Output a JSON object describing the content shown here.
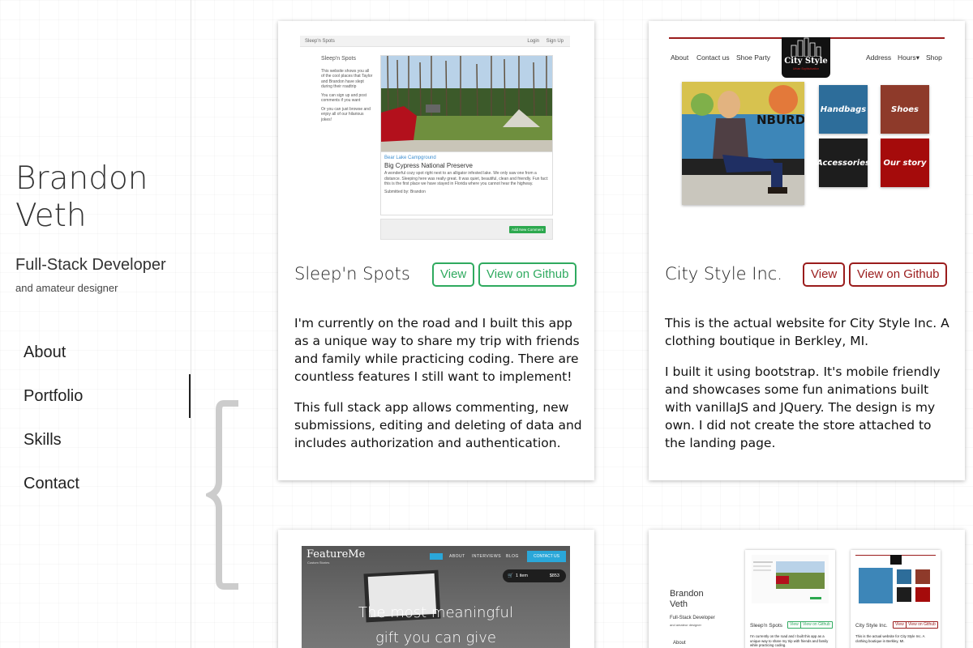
{
  "sidebar": {
    "name": "Brandon\nVeth",
    "role": "Full-Stack Developer",
    "subtitle": "and amateur designer",
    "nav": [
      {
        "label": "About"
      },
      {
        "label": "Portfolio",
        "active": true
      },
      {
        "label": "Skills"
      },
      {
        "label": "Contact"
      }
    ]
  },
  "projects": [
    {
      "title": "Sleep'n Spots",
      "view_label": "View",
      "github_label": "View on Github",
      "accent": "#2faa5f",
      "paragraphs": [
        "I'm currently on the road and I built this app as a unique way to share my trip with friends and family while practicing coding. There are countless features I still want to implement!",
        "This full stack app allows commenting, new submissions, editing and deleting of data and includes authorization and authentication."
      ],
      "preview": {
        "brand": "Sleep'n Spots",
        "login": "Login",
        "signup": "Sign Up",
        "side_heading": "Sleep'n Spots",
        "side_p1": "This website shows you all of the cool places that Taylor and Brandon have slept during their roadtrip",
        "side_p2": "You can sign up and post comments if you want",
        "side_p3": "Or you can just browse and enjoy all of our hilarious jokes!",
        "location": "Bear Lake Campground",
        "post_title": "Big Cypress National Preserve",
        "post_text": "A wonderful cozy spot right next to an alligator infested lake. We only saw one from a distance. Sleeping here was really great. It was quiet, beautiful, clean and friendly. Fun fact: this is the first place we have stayed in Florida where you cannot hear the highway.",
        "submitted": "Submitted by: Brandon",
        "add_comment": "Add New Comment"
      }
    },
    {
      "title": "City Style Inc.",
      "view_label": "View",
      "github_label": "View on Github",
      "accent": "#9a1c1c",
      "paragraphs": [
        "This is the actual website for City Style Inc. A clothing boutique in Berkley, MI.",
        "I built it using bootstrap. It's mobile friendly and showcases some fun animations built with vanillaJS and JQuery. The design is my own. I did not create the store attached to the landing page."
      ],
      "preview": {
        "nav_about": "About",
        "nav_contact": "Contact us",
        "nav_shoe": "Shoe Party",
        "logo": "City Style",
        "logo_sub": "Urban Sophistication",
        "nav_address": "Address",
        "nav_hours": "Hours",
        "nav_shop": "Shop",
        "tile_handbags": "Handbags",
        "tile_shoes": "Shoes",
        "tile_accessories": "Accessories",
        "tile_story": "Our story"
      }
    },
    {
      "preview": {
        "logo": "FeatureMe",
        "logo_sub": "Custom Stories",
        "nav_about": "ABOUT",
        "nav_interviews": "INTERVIEWS",
        "nav_blog": "BLOG",
        "nav_contact": "CONTACT US",
        "cart_items": "1 item",
        "cart_total": "$853",
        "headline_1": "The most meaningful",
        "headline_2": "gift you can give"
      }
    },
    {
      "preview": {
        "name": "Brandon\nVeth",
        "role": "Full-Stack Developer",
        "subtitle": "and amateur designer",
        "about": "About",
        "card1_title": "Sleep'n Spots",
        "card1_desc": "I'm currently on the road and I built this app as a unique way to share my trip with friends and family while practicing coding.",
        "card2_title": "City Style Inc.",
        "card2_desc": "This is the actual website for City Style Inc. A clothing boutique in Berkley, MI.",
        "view": "View",
        "github": "View on Github"
      }
    }
  ]
}
